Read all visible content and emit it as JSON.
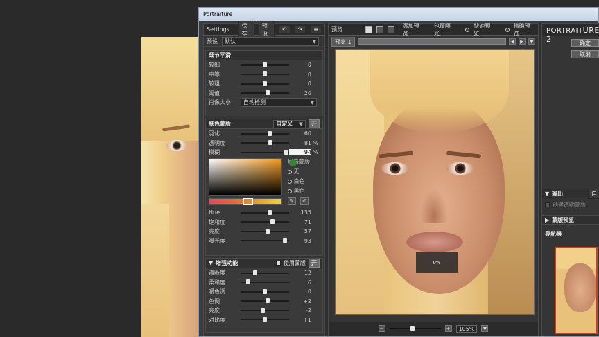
{
  "window": {
    "title": "Portraiture"
  },
  "left": {
    "toolbar": {
      "settings": "Settings",
      "save": "保存",
      "preset": "预设",
      "undo": "↶",
      "redo": "↷"
    },
    "preset_row": {
      "label": "预设",
      "value": "默认"
    },
    "detail": {
      "title": "细节平滑",
      "rows": [
        {
          "label": "较细",
          "value": "0",
          "pos": 0.5
        },
        {
          "label": "中等",
          "value": "0",
          "pos": 0.5
        },
        {
          "label": "较粗",
          "value": "0",
          "pos": 0.5
        },
        {
          "label": "阈值",
          "value": "20",
          "pos": 0.55
        }
      ],
      "size_label": "肖像大小",
      "size_value": "自动检测"
    },
    "skin": {
      "title": "肤色蒙版",
      "mode": "自定义",
      "on": "开",
      "rows": [
        {
          "label": "羽化",
          "value": "60",
          "unit": "",
          "pos": 0.6
        },
        {
          "label": "透明度",
          "value": "81",
          "unit": "%",
          "pos": 0.62
        },
        {
          "label": "模糊",
          "value": "94",
          "unit": "%",
          "pos": 0.94
        }
      ],
      "display_label": "显示蒙版:",
      "display_options": [
        "无",
        "白色",
        "黑色"
      ],
      "display_selected": 0,
      "hsl_rows": [
        {
          "label": "Hue",
          "value": "135",
          "pos": 0.6
        },
        {
          "label": "饱和度",
          "value": "71",
          "pos": 0.65
        },
        {
          "label": "亮度",
          "value": "57",
          "pos": 0.55
        },
        {
          "label": "曝光度",
          "value": "93",
          "pos": 0.92
        }
      ]
    },
    "enhance": {
      "title": "增强功能",
      "use_mask": "使用蒙版",
      "on": "开",
      "rows": [
        {
          "label": "清晰度",
          "value": "12",
          "pos": 0.3
        },
        {
          "label": "柔和度",
          "value": "6",
          "pos": 0.15
        },
        {
          "label": "暖色调",
          "value": "0",
          "pos": 0.5
        },
        {
          "label": "色调",
          "value": "+2",
          "pos": 0.55
        },
        {
          "label": "亮度",
          "value": "-2",
          "pos": 0.45
        },
        {
          "label": "对比度",
          "value": "+1",
          "pos": 0.5
        }
      ]
    }
  },
  "center": {
    "title": "预览",
    "add_preview": "添加预览",
    "clip": "包覆曝光",
    "fast": "快速预览",
    "accurate": "精确预览",
    "tab": "预览 1",
    "overlay_text": "0%",
    "zoom": "105%",
    "zoom_pos": 0.45
  },
  "right": {
    "brand_a": "PORTRAIT",
    "brand_b": "URE 2",
    "ok": "确定",
    "cancel": "取消",
    "output": "输出",
    "output_btn": "自",
    "output_option": "创建透明蒙版",
    "mask_preview": "蒙版预览",
    "navigator": "导航器"
  }
}
